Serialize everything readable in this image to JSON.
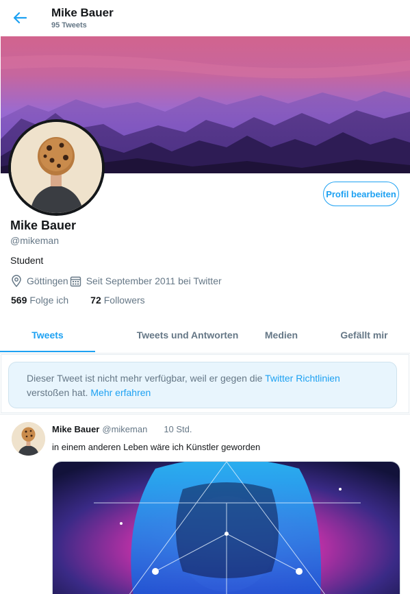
{
  "header": {
    "title": "Mike Bauer",
    "tweet_count": "95 Tweets"
  },
  "profile": {
    "name": "Mike Bauer",
    "handle": "@mikeman",
    "bio": "Student",
    "location": "Göttingen",
    "joined": "Seit September 2011 bei Twitter",
    "following_count": "569",
    "following_label": "Folge ich",
    "followers_count": "72",
    "followers_label": "Followers",
    "edit_button": "Profil bearbeiten"
  },
  "tabs": [
    {
      "label": "Tweets",
      "active": true
    },
    {
      "label": "Tweets und Antworten",
      "active": false
    },
    {
      "label": "Medien",
      "active": false
    },
    {
      "label": "Gefällt mir",
      "active": false
    }
  ],
  "notice": {
    "text1": "Dieser Tweet ist nicht mehr verfügbar, weil er gegen die ",
    "link1": "Twitter Richtlinien",
    "text2": "verstoßen hat. ",
    "link2": "Mehr erfahren"
  },
  "tweet": {
    "name": "Mike Bauer",
    "handle": "@mikeman",
    "time": "10 Std.",
    "text": "in einem anderen Leben wäre ich Künstler geworden"
  },
  "icons": {
    "back": "arrow-left-icon",
    "location": "map-pin-icon",
    "calendar": "calendar-icon"
  },
  "colors": {
    "accent": "#1da1f2",
    "secondary_text": "#657786",
    "notice_bg": "#e8f5fd"
  }
}
